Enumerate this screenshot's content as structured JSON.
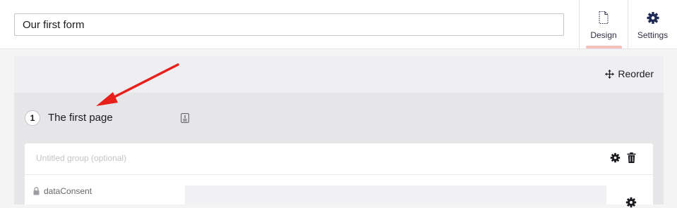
{
  "form": {
    "name_value": "Our first form"
  },
  "tabs": [
    {
      "label": "Design",
      "icon": "document-icon",
      "active": true
    },
    {
      "label": "Settings",
      "icon": "gear-icon",
      "active": false
    }
  ],
  "toolbar": {
    "reorder_label": "Reorder"
  },
  "page": {
    "number": "1",
    "title": "The first page"
  },
  "group": {
    "name_placeholder": "Untitled group (optional)"
  },
  "property": {
    "alias": "dataConsent"
  },
  "colors": {
    "active_tab_indicator": "#f5c1bc",
    "annotation_arrow": "#e8201c",
    "canvas_bg": "#efeff1",
    "page_bg": "#e6e6e9"
  }
}
